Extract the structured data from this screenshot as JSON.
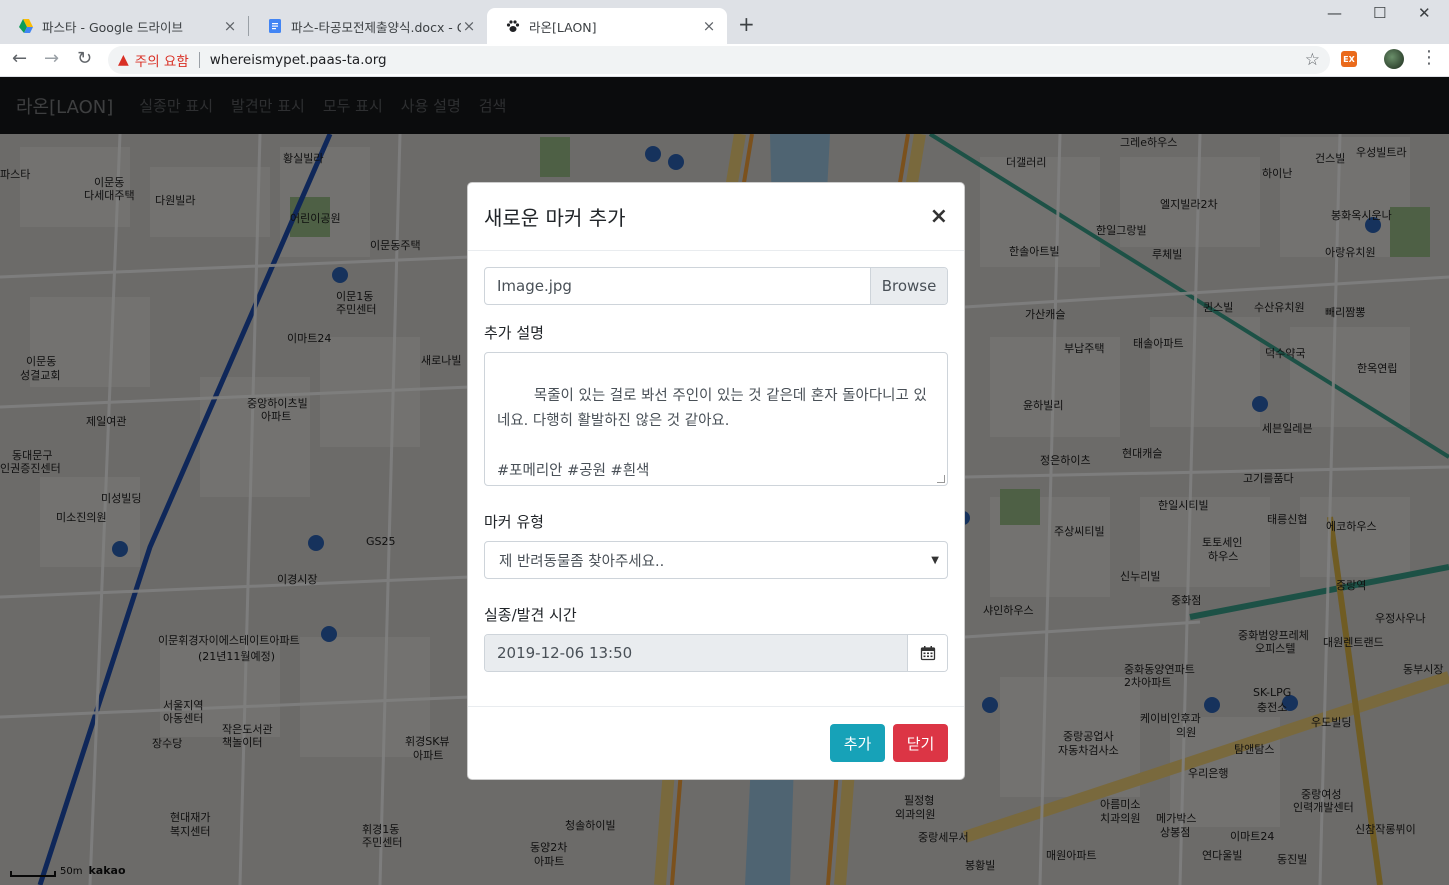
{
  "browser": {
    "tabs": [
      {
        "title": "파스타 - Google 드라이브",
        "active": false
      },
      {
        "title": "파스-타공모전제출양식.docx - G",
        "active": false
      },
      {
        "title": "라온[LAON]",
        "active": true
      }
    ],
    "new_tab": "+",
    "tab_close": "×",
    "window": {
      "minimize": "—",
      "maximize": "☐",
      "close": "✕"
    },
    "nav": {
      "back": "←",
      "forward": "→",
      "reload": "↻"
    },
    "security_icon": "▲",
    "security_warning": "주의 요함",
    "url": "whereismypet.paas-ta.org",
    "bookmark_star": "☆",
    "extension_label": "EX",
    "menu": "⋮"
  },
  "navbar": {
    "brand": "라온[LAON]",
    "links": [
      "실종만 표시",
      "발견만 표시",
      "모두 표시",
      "사용 설명",
      "검색"
    ]
  },
  "map": {
    "attribution": "kakao",
    "scale": "50m",
    "labels": [
      "파스타",
      "이문동",
      "다세대주택",
      "다원빌라",
      "황실빌라",
      "어린이공원",
      "이문동주택",
      "이문1동",
      "주민센터",
      "이마트24",
      "이문동",
      "성결교회",
      "제일여관",
      "동대문구",
      "인권증진센터",
      "미성빌딩",
      "미소진의원",
      "새로나빌",
      "중앙하이츠빌",
      "아파트",
      "GS25",
      "이경시장",
      "이문휘경자이에스테이트아파트",
      "(21년11월예정)",
      "서울지역",
      "아동센터",
      "작은도서관",
      "책놀이터",
      "장수당",
      "현대재가",
      "복지센터",
      "휘경SK뷰",
      "아파트",
      "휘경1동",
      "주민센터",
      "청솔하이빌",
      "동양2차",
      "아파트",
      "더갤러리",
      "한일그랑빌",
      "한솔아트빌",
      "가산캐슬",
      "부납주택",
      "윤하빌리",
      "정은하이츠",
      "현대캐슬",
      "한일시티빌",
      "주상씨티빌",
      "신누리빌",
      "샤인하우스",
      "중화동양연파트",
      "2차아파트",
      "케이비인후과",
      "의원",
      "중랑공업사",
      "자동차검사소",
      "우리은행",
      "필정형",
      "외과의원",
      "중랑세무서",
      "아름미소",
      "치과의원",
      "메가박스",
      "상봉점",
      "매원아파트",
      "봉황빌",
      "연다울빌",
      "그레e하우스",
      "엘지빌라2차",
      "루체빌",
      "퀸스빌",
      "태솔아파트",
      "세븐일레븐",
      "고기를품다",
      "토토세인",
      "하우스",
      "태릉신협",
      "에코하우스",
      "중화점",
      "중화범양프레체",
      "오피스텔",
      "대원렌트랜드",
      "SK-LPG",
      "충전소",
      "우도빌딩",
      "탐앤탐스",
      "중랑여성",
      "인력개발센터",
      "신참작롱뷔이",
      "이마트24",
      "동진빌",
      "건스빌",
      "우성빌트라",
      "하이난",
      "봉화옥시운나",
      "아랑유치원",
      "수산유치원",
      "빼리짬뽕",
      "덕수약국",
      "한옥연립",
      "우정사우나",
      "중랑역",
      "동부시장"
    ]
  },
  "modal": {
    "title": "새로운 마커 추가",
    "close": "×",
    "file": {
      "value": "Image.jpg",
      "browse": "Browse"
    },
    "description_label": "추가 설명",
    "description": "목줄이 있는 걸로 봐선 주인이 있는 것 같은데 혼자 돌아다니고 있네요. 다행히 활발하진 않은 것 같아요.\n\n#포메리안 #공원 #흰색",
    "marker_type_label": "마커 유형",
    "marker_type_selected": "제 반려동물좀 찾아주세요..",
    "time_label": "실종/발견 시간",
    "time_value": "2019-12-06 13:50",
    "buttons": {
      "add": "추가",
      "close": "닫기"
    }
  },
  "colors": {
    "brand_accent": "#17a2b8",
    "danger": "#dc3545",
    "warning": "#d93025",
    "navbar_bg": "#16181a"
  }
}
